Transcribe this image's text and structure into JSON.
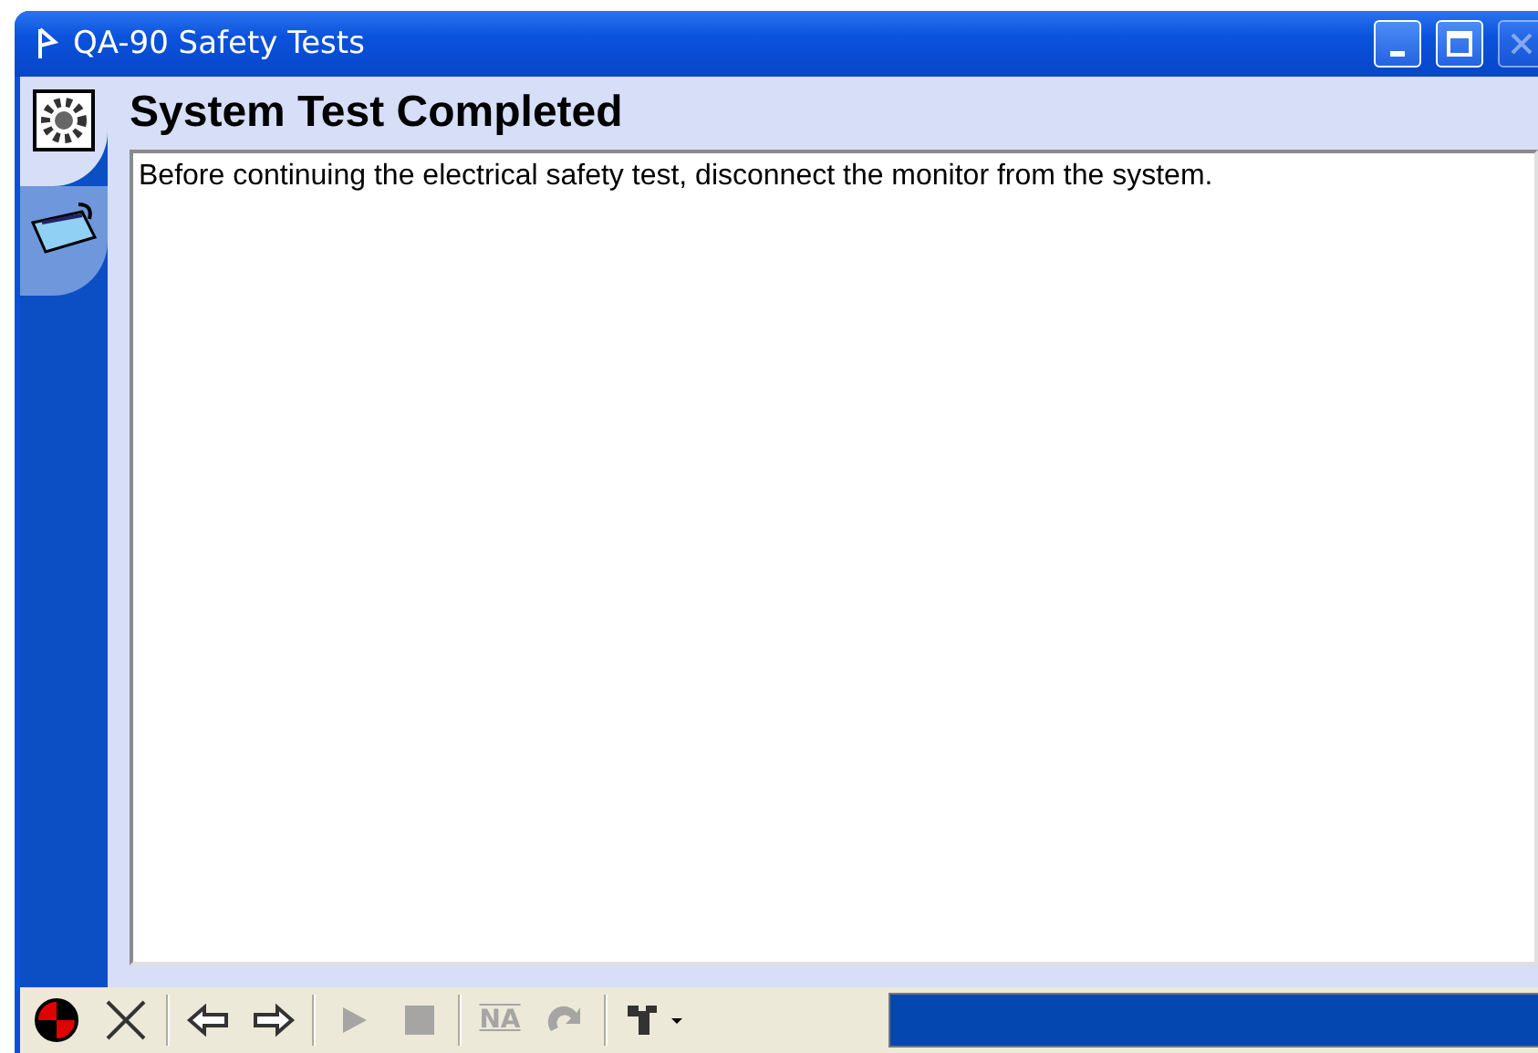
{
  "window": {
    "title": "QA-90 Safety Tests"
  },
  "side_tabs": [
    {
      "kind": "gear",
      "selected": true
    },
    {
      "kind": "tray",
      "selected": false
    }
  ],
  "heading": "System Test Completed",
  "message": "Before continuing the electrical safety test, disconnect the monitor from the system.",
  "toolbar": [
    {
      "kind": "record",
      "disabled": false
    },
    {
      "kind": "cancel",
      "disabled": false
    },
    {
      "kind": "sep"
    },
    {
      "kind": "back",
      "disabled": false
    },
    {
      "kind": "forward",
      "disabled": false
    },
    {
      "kind": "sep"
    },
    {
      "kind": "play",
      "disabled": true
    },
    {
      "kind": "stop",
      "disabled": true
    },
    {
      "kind": "sep"
    },
    {
      "kind": "na",
      "label": "NA",
      "disabled": true
    },
    {
      "kind": "redo",
      "disabled": true
    },
    {
      "kind": "sep"
    },
    {
      "kind": "tools",
      "disabled": false
    }
  ],
  "progress": {
    "level": 1
  }
}
